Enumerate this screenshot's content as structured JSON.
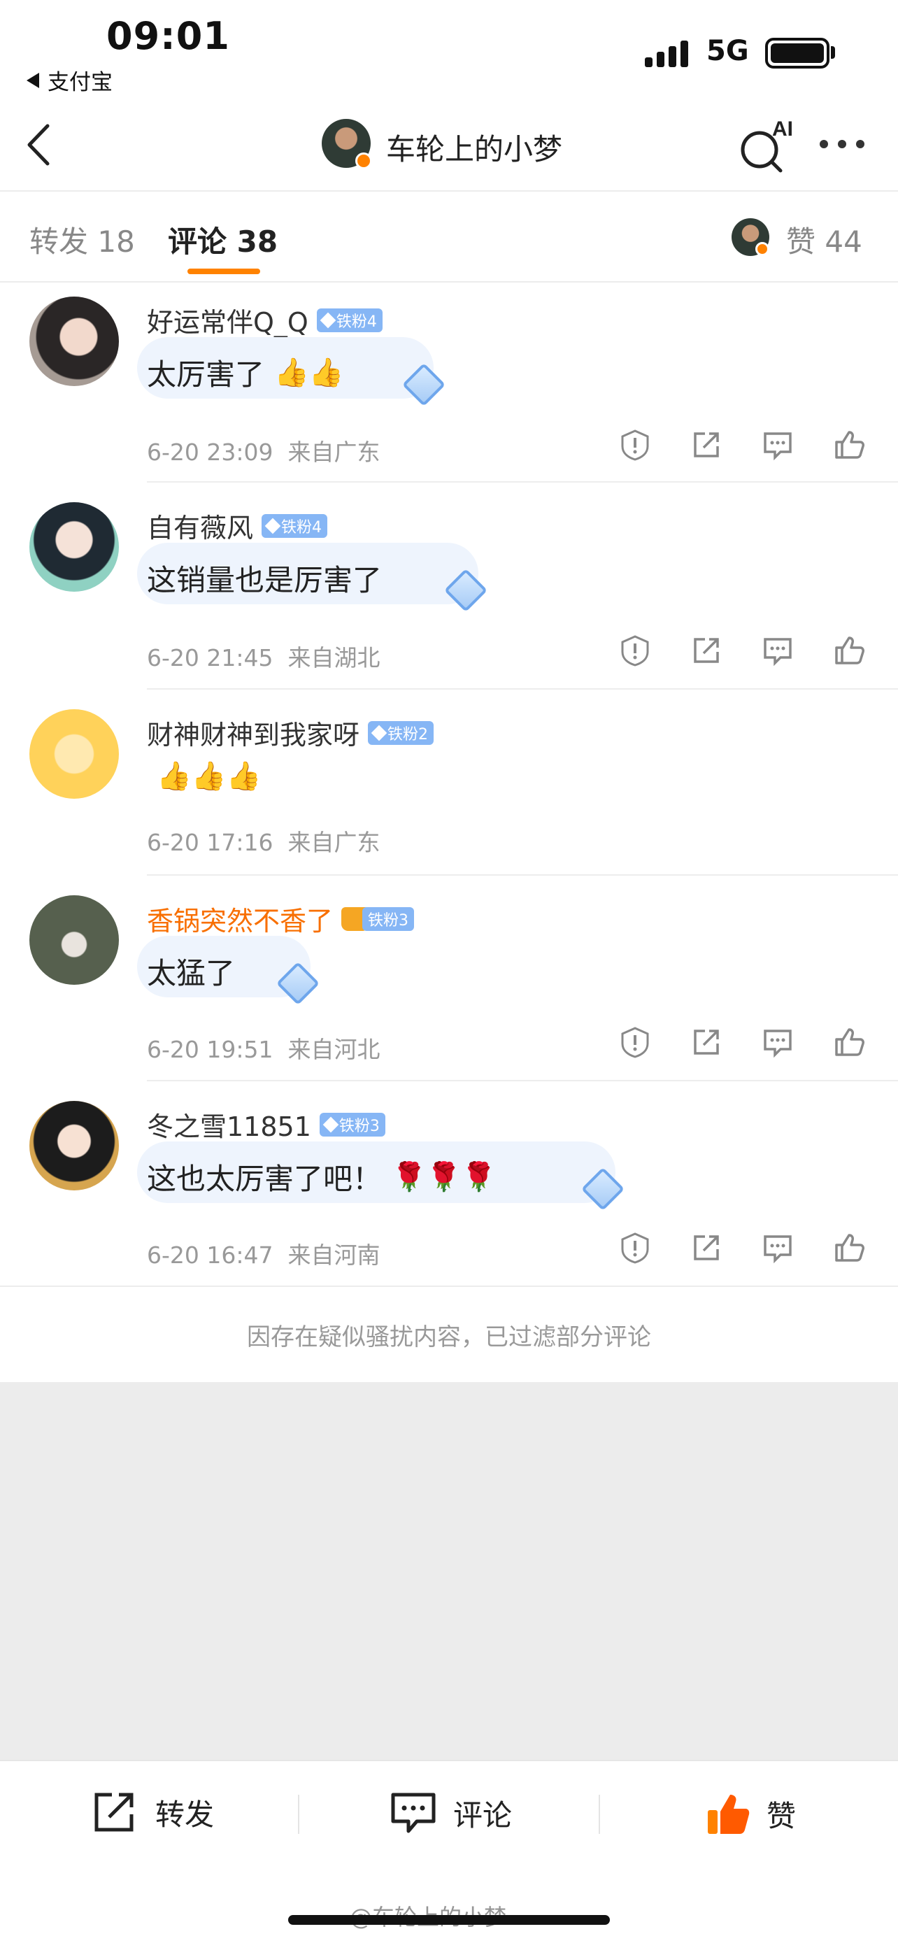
{
  "status_bar": {
    "time": "09:01",
    "back_app": "支付宝",
    "network": "5G"
  },
  "nav": {
    "title": "车轮上的小梦",
    "ai_label": "AI"
  },
  "tabs": {
    "repost_label": "转发",
    "repost_count": "18",
    "comment_label": "评论",
    "comment_count": "38",
    "like_label": "赞",
    "like_count": "44"
  },
  "comments": [
    {
      "user": "好运常伴Q_Q",
      "badge": "铁粉4",
      "text": "太厉害了",
      "emojis": "👍👍",
      "time": "6-20 23:09",
      "location": "来自广东"
    },
    {
      "user": "自有薇风",
      "badge": "铁粉4",
      "text": "这销量也是厉害了",
      "emojis": "",
      "time": "6-20 21:45",
      "location": "来自湖北"
    },
    {
      "user": "财神财神到我家呀",
      "badge": "铁粉2",
      "text": "",
      "emojis": "👍👍👍",
      "time": "6-20 17:16",
      "location": "来自广东"
    },
    {
      "user": "香锅突然不香了",
      "badge": "铁粉3",
      "text": "太猛了",
      "emojis": "",
      "time": "6-20 19:51",
      "location": "来自河北"
    },
    {
      "user": "冬之雪11851",
      "badge": "铁粉3",
      "text": "这也太厉害了吧！",
      "emojis": "🌹🌹🌹",
      "time": "6-20 16:47",
      "location": "来自河南"
    }
  ],
  "filter_note": "因存在疑似骚扰内容，已过滤部分评论",
  "bottom_bar": {
    "repost": "转发",
    "comment": "评论",
    "like": "赞"
  },
  "watermark": "@车轮上的小梦",
  "colors": {
    "accent": "#ff8200",
    "orange_name": "#f86f00",
    "fan_badge": "#86b6f5"
  }
}
